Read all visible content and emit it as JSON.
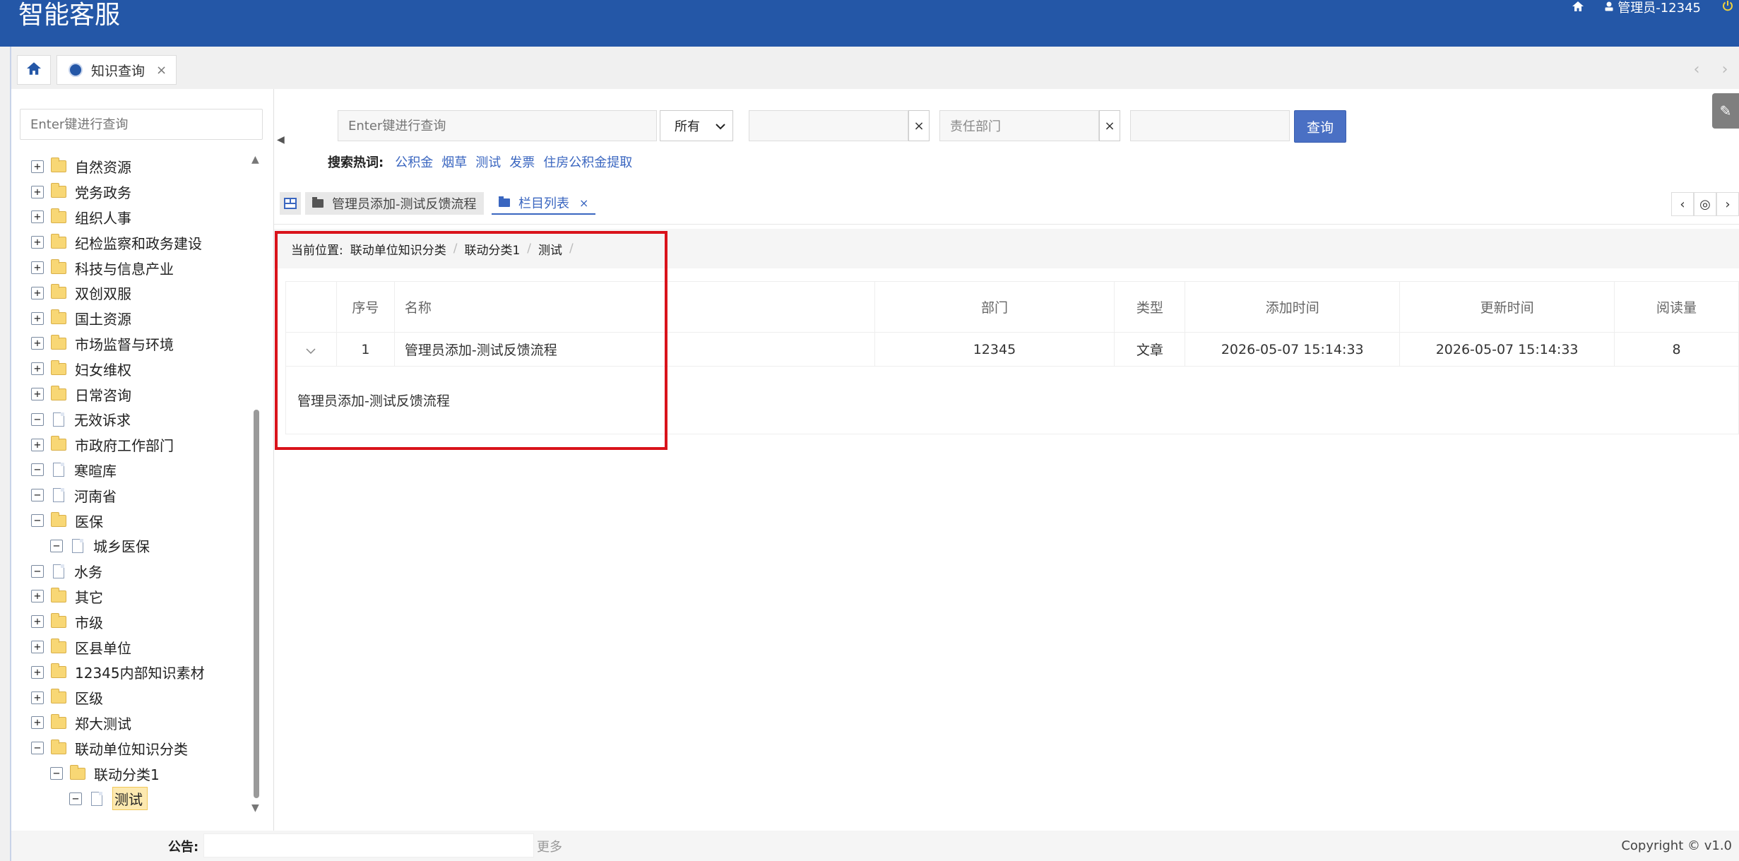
{
  "header": {
    "title": "智能客服",
    "user": "管理员-12345"
  },
  "tabbar": {
    "active_tab": "知识查询",
    "close": "×"
  },
  "sidebar": {
    "search_placeholder": "Enter键进行查询",
    "tree": [
      {
        "label": "自然资源",
        "type": "folder",
        "toggle": "+",
        "level": 0
      },
      {
        "label": "党务政务",
        "type": "folder",
        "toggle": "+",
        "level": 0
      },
      {
        "label": "组织人事",
        "type": "folder",
        "toggle": "+",
        "level": 0
      },
      {
        "label": "纪检监察和政务建设",
        "type": "folder",
        "toggle": "+",
        "level": 0
      },
      {
        "label": "科技与信息产业",
        "type": "folder",
        "toggle": "+",
        "level": 0
      },
      {
        "label": "双创双服",
        "type": "folder",
        "toggle": "+",
        "level": 0
      },
      {
        "label": "国土资源",
        "type": "folder",
        "toggle": "+",
        "level": 0
      },
      {
        "label": "市场监督与环境",
        "type": "folder",
        "toggle": "+",
        "level": 0
      },
      {
        "label": "妇女维权",
        "type": "folder",
        "toggle": "+",
        "level": 0
      },
      {
        "label": "日常咨询",
        "type": "folder",
        "toggle": "+",
        "level": 0
      },
      {
        "label": "无效诉求",
        "type": "doc",
        "toggle": "−",
        "level": 0
      },
      {
        "label": "市政府工作部门",
        "type": "folder",
        "toggle": "+",
        "level": 0
      },
      {
        "label": "寒暄库",
        "type": "doc",
        "toggle": "−",
        "level": 0
      },
      {
        "label": "河南省",
        "type": "doc",
        "toggle": "−",
        "level": 0
      },
      {
        "label": "医保",
        "type": "folder",
        "toggle": "−",
        "level": 0
      },
      {
        "label": "城乡医保",
        "type": "doc",
        "toggle": "−",
        "level": 1
      },
      {
        "label": "水务",
        "type": "doc",
        "toggle": "−",
        "level": 0
      },
      {
        "label": "其它",
        "type": "folder",
        "toggle": "+",
        "level": 0
      },
      {
        "label": "市级",
        "type": "folder",
        "toggle": "+",
        "level": 0
      },
      {
        "label": "区县单位",
        "type": "folder",
        "toggle": "+",
        "level": 0
      },
      {
        "label": "12345内部知识素材",
        "type": "folder",
        "toggle": "+",
        "level": 0
      },
      {
        "label": "区级",
        "type": "folder",
        "toggle": "+",
        "level": 0
      },
      {
        "label": "郑大测试",
        "type": "folder",
        "toggle": "+",
        "level": 0
      },
      {
        "label": "联动单位知识分类",
        "type": "folder",
        "toggle": "−",
        "level": 0
      },
      {
        "label": "联动分类1",
        "type": "folder",
        "toggle": "−",
        "level": 1
      },
      {
        "label": "测试",
        "type": "doc",
        "toggle": "−",
        "level": 2,
        "selected": true
      }
    ]
  },
  "search": {
    "keyword_placeholder": "Enter键进行查询",
    "scope_value": "所有",
    "dept_placeholder": "责任部门",
    "clear": "×",
    "button": "查询",
    "hot_label": "搜索热词:",
    "hot_words": [
      "公积金",
      "烟草",
      "测试",
      "发票",
      "住房公积金提取"
    ]
  },
  "subtabs": {
    "tab1": "管理员添加-测试反馈流程",
    "tab2": "栏目列表",
    "close": "×"
  },
  "breadcrumb": {
    "label": "当前位置:",
    "items": [
      "联动单位知识分类",
      "联动分类1",
      "测试"
    ],
    "sep": "/"
  },
  "table": {
    "headers": [
      "序号",
      "名称",
      "部门",
      "类型",
      "添加时间",
      "更新时间",
      "阅读量"
    ],
    "rows": [
      {
        "index": "1",
        "name": "管理员添加-测试反馈流程",
        "dept": "12345",
        "type": "文章",
        "added": "2026-05-07 15:14:33",
        "updated": "2026-05-07 15:14:33",
        "reads": "8",
        "detail": "管理员添加-测试反馈流程"
      }
    ]
  },
  "footer": {
    "notice_label": "公告:",
    "more": "更多",
    "copyright": "Copyright © v1.0"
  },
  "colors": {
    "header_bg": "#2457a7",
    "primary_button": "#4a70c4",
    "link": "#3a66c0",
    "highlight": "#d9131b"
  }
}
